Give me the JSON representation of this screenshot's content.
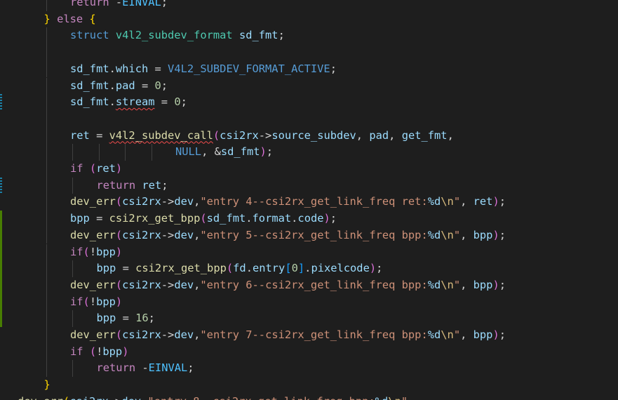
{
  "theme": {
    "background": "#1e1e1e",
    "colors": {
      "default": "#d4d4d4",
      "variable": "#9cdcfe",
      "keyword_control": "#c586c0",
      "keyword_type": "#569cd6",
      "type": "#4ec9b0",
      "function": "#dcdcaa",
      "string": "#ce9178",
      "number": "#b5cea8",
      "constant": "#4fc1ff",
      "escape": "#d7ba7d",
      "macro": "#569cd6",
      "bracket_yellow": "#ffd700",
      "bracket_purple": "#da70d6",
      "bracket_blue": "#179fff",
      "error_squiggle": "#f14c4c"
    },
    "gutter_marks": [
      {
        "line": 6,
        "span": 1,
        "color": "#1b81a8",
        "style": "dashed"
      },
      {
        "line": 11,
        "span": 1,
        "color": "#1b81a8",
        "style": "dashed"
      },
      {
        "line": 13,
        "span": 7,
        "color": "#487e02",
        "style": "solid"
      }
    ]
  },
  "lines": [
    {
      "indent": 2,
      "guides": [
        1
      ],
      "tokens": [
        {
          "t": "return",
          "c": "keyword_control"
        },
        {
          "t": " -"
        },
        {
          "t": "EINVAL",
          "c": "constant"
        },
        {
          "t": ";"
        }
      ]
    },
    {
      "indent": 1,
      "guides": [],
      "tokens": [
        {
          "t": "}",
          "c": "bracket_yellow"
        },
        {
          "t": " "
        },
        {
          "t": "else",
          "c": "keyword_control"
        },
        {
          "t": " "
        },
        {
          "t": "{",
          "c": "bracket_yellow"
        }
      ]
    },
    {
      "indent": 2,
      "guides": [
        1
      ],
      "tokens": [
        {
          "t": "struct",
          "c": "keyword_type"
        },
        {
          "t": " "
        },
        {
          "t": "v4l2_subdev_format",
          "c": "type"
        },
        {
          "t": " "
        },
        {
          "t": "sd_fmt",
          "c": "variable"
        },
        {
          "t": ";"
        }
      ]
    },
    {
      "indent": 0,
      "guides": [
        1
      ],
      "tokens": []
    },
    {
      "indent": 2,
      "guides": [
        1
      ],
      "tokens": [
        {
          "t": "sd_fmt",
          "c": "variable"
        },
        {
          "t": "."
        },
        {
          "t": "which",
          "c": "variable"
        },
        {
          "t": " = "
        },
        {
          "t": "V4L2_SUBDEV_FORMAT_ACTIVE",
          "c": "macro"
        },
        {
          "t": ";"
        }
      ]
    },
    {
      "indent": 2,
      "guides": [
        1
      ],
      "tokens": [
        {
          "t": "sd_fmt",
          "c": "variable"
        },
        {
          "t": "."
        },
        {
          "t": "pad",
          "c": "variable"
        },
        {
          "t": " = "
        },
        {
          "t": "0",
          "c": "number"
        },
        {
          "t": ";"
        }
      ]
    },
    {
      "indent": 2,
      "guides": [
        1
      ],
      "tokens": [
        {
          "t": "sd_fmt",
          "c": "variable"
        },
        {
          "t": "."
        },
        {
          "t": "stream",
          "c": "variable",
          "squiggle": true
        },
        {
          "t": " = "
        },
        {
          "t": "0",
          "c": "number"
        },
        {
          "t": ";"
        }
      ]
    },
    {
      "indent": 0,
      "guides": [
        1
      ],
      "tokens": []
    },
    {
      "indent": 2,
      "guides": [
        1
      ],
      "tokens": [
        {
          "t": "ret",
          "c": "variable"
        },
        {
          "t": " = "
        },
        {
          "t": "v4l2_subdev_call",
          "c": "function",
          "squiggle": true
        },
        {
          "t": "(",
          "c": "bracket_purple"
        },
        {
          "t": "csi2rx",
          "c": "variable"
        },
        {
          "t": "->"
        },
        {
          "t": "source_subdev",
          "c": "variable"
        },
        {
          "t": ", "
        },
        {
          "t": "pad",
          "c": "variable"
        },
        {
          "t": ", "
        },
        {
          "t": "get_fmt",
          "c": "variable"
        },
        {
          "t": ","
        }
      ]
    },
    {
      "indent": 6,
      "guides": [
        1,
        2,
        3,
        4,
        5
      ],
      "tokens": [
        {
          "t": "NULL",
          "c": "macro"
        },
        {
          "t": ", &"
        },
        {
          "t": "sd_fmt",
          "c": "variable"
        },
        {
          "t": ")",
          "c": "bracket_purple"
        },
        {
          "t": ";"
        }
      ]
    },
    {
      "indent": 2,
      "guides": [
        1
      ],
      "tokens": [
        {
          "t": "if",
          "c": "keyword_control"
        },
        {
          "t": " "
        },
        {
          "t": "(",
          "c": "bracket_purple"
        },
        {
          "t": "ret",
          "c": "variable"
        },
        {
          "t": ")",
          "c": "bracket_purple"
        }
      ]
    },
    {
      "indent": 3,
      "guides": [
        1,
        2
      ],
      "tokens": [
        {
          "t": "return",
          "c": "keyword_control"
        },
        {
          "t": " "
        },
        {
          "t": "ret",
          "c": "variable"
        },
        {
          "t": ";"
        }
      ]
    },
    {
      "indent": 2,
      "guides": [
        1
      ],
      "tokens": [
        {
          "t": "dev_err",
          "c": "function"
        },
        {
          "t": "(",
          "c": "bracket_purple"
        },
        {
          "t": "csi2rx",
          "c": "variable"
        },
        {
          "t": "->"
        },
        {
          "t": "dev",
          "c": "variable"
        },
        {
          "t": ","
        },
        {
          "t": "\"entry 4--csi2rx_get_link_freq ret:",
          "c": "string"
        },
        {
          "t": "%d",
          "c": "variable"
        },
        {
          "t": "\\n",
          "c": "escape"
        },
        {
          "t": "\"",
          "c": "string"
        },
        {
          "t": ", "
        },
        {
          "t": "ret",
          "c": "variable"
        },
        {
          "t": ")",
          "c": "bracket_purple"
        },
        {
          "t": ";"
        }
      ]
    },
    {
      "indent": 2,
      "guides": [
        1
      ],
      "tokens": [
        {
          "t": "bpp",
          "c": "variable"
        },
        {
          "t": " = "
        },
        {
          "t": "csi2rx_get_bpp",
          "c": "function"
        },
        {
          "t": "(",
          "c": "bracket_purple"
        },
        {
          "t": "sd_fmt",
          "c": "variable"
        },
        {
          "t": "."
        },
        {
          "t": "format",
          "c": "variable"
        },
        {
          "t": "."
        },
        {
          "t": "code",
          "c": "variable"
        },
        {
          "t": ")",
          "c": "bracket_purple"
        },
        {
          "t": ";"
        }
      ]
    },
    {
      "indent": 2,
      "guides": [
        1
      ],
      "tokens": [
        {
          "t": "dev_err",
          "c": "function"
        },
        {
          "t": "(",
          "c": "bracket_purple"
        },
        {
          "t": "csi2rx",
          "c": "variable"
        },
        {
          "t": "->"
        },
        {
          "t": "dev",
          "c": "variable"
        },
        {
          "t": ","
        },
        {
          "t": "\"entry 5--csi2rx_get_link_freq bpp:",
          "c": "string"
        },
        {
          "t": "%d",
          "c": "variable"
        },
        {
          "t": "\\n",
          "c": "escape"
        },
        {
          "t": "\"",
          "c": "string"
        },
        {
          "t": ", "
        },
        {
          "t": "bpp",
          "c": "variable"
        },
        {
          "t": ")",
          "c": "bracket_purple"
        },
        {
          "t": ";"
        }
      ]
    },
    {
      "indent": 2,
      "guides": [
        1
      ],
      "tokens": [
        {
          "t": "if",
          "c": "keyword_control"
        },
        {
          "t": "(",
          "c": "bracket_purple"
        },
        {
          "t": "!"
        },
        {
          "t": "bpp",
          "c": "variable"
        },
        {
          "t": ")",
          "c": "bracket_purple"
        }
      ]
    },
    {
      "indent": 3,
      "guides": [
        1,
        2
      ],
      "tokens": [
        {
          "t": "bpp",
          "c": "variable"
        },
        {
          "t": " = "
        },
        {
          "t": "csi2rx_get_bpp",
          "c": "function"
        },
        {
          "t": "(",
          "c": "bracket_purple"
        },
        {
          "t": "fd",
          "c": "variable"
        },
        {
          "t": "."
        },
        {
          "t": "entry",
          "c": "variable"
        },
        {
          "t": "[",
          "c": "bracket_blue"
        },
        {
          "t": "0",
          "c": "number"
        },
        {
          "t": "]",
          "c": "bracket_blue"
        },
        {
          "t": "."
        },
        {
          "t": "pixelcode",
          "c": "variable"
        },
        {
          "t": ")",
          "c": "bracket_purple"
        },
        {
          "t": ";"
        }
      ]
    },
    {
      "indent": 2,
      "guides": [
        1
      ],
      "tokens": [
        {
          "t": "dev_err",
          "c": "function"
        },
        {
          "t": "(",
          "c": "bracket_purple"
        },
        {
          "t": "csi2rx",
          "c": "variable"
        },
        {
          "t": "->"
        },
        {
          "t": "dev",
          "c": "variable"
        },
        {
          "t": ","
        },
        {
          "t": "\"entry 6--csi2rx_get_link_freq bpp:",
          "c": "string"
        },
        {
          "t": "%d",
          "c": "variable"
        },
        {
          "t": "\\n",
          "c": "escape"
        },
        {
          "t": "\"",
          "c": "string"
        },
        {
          "t": ", "
        },
        {
          "t": "bpp",
          "c": "variable"
        },
        {
          "t": ")",
          "c": "bracket_purple"
        },
        {
          "t": ";"
        }
      ]
    },
    {
      "indent": 2,
      "guides": [
        1
      ],
      "tokens": [
        {
          "t": "if",
          "c": "keyword_control"
        },
        {
          "t": "(",
          "c": "bracket_purple"
        },
        {
          "t": "!"
        },
        {
          "t": "bpp",
          "c": "variable"
        },
        {
          "t": ")",
          "c": "bracket_purple"
        }
      ]
    },
    {
      "indent": 3,
      "guides": [
        1,
        2
      ],
      "tokens": [
        {
          "t": "bpp",
          "c": "variable"
        },
        {
          "t": " = "
        },
        {
          "t": "16",
          "c": "number"
        },
        {
          "t": ";"
        }
      ]
    },
    {
      "indent": 2,
      "guides": [
        1
      ],
      "tokens": [
        {
          "t": "dev_err",
          "c": "function"
        },
        {
          "t": "(",
          "c": "bracket_purple"
        },
        {
          "t": "csi2rx",
          "c": "variable"
        },
        {
          "t": "->"
        },
        {
          "t": "dev",
          "c": "variable"
        },
        {
          "t": ","
        },
        {
          "t": "\"entry 7--csi2rx_get_link_freq bpp:",
          "c": "string"
        },
        {
          "t": "%d",
          "c": "variable"
        },
        {
          "t": "\\n",
          "c": "escape"
        },
        {
          "t": "\"",
          "c": "string"
        },
        {
          "t": ", "
        },
        {
          "t": "bpp",
          "c": "variable"
        },
        {
          "t": ")",
          "c": "bracket_purple"
        },
        {
          "t": ";"
        }
      ]
    },
    {
      "indent": 2,
      "guides": [
        1
      ],
      "tokens": [
        {
          "t": "if",
          "c": "keyword_control"
        },
        {
          "t": " "
        },
        {
          "t": "(",
          "c": "bracket_purple"
        },
        {
          "t": "!"
        },
        {
          "t": "bpp",
          "c": "variable"
        },
        {
          "t": ")",
          "c": "bracket_purple"
        }
      ]
    },
    {
      "indent": 3,
      "guides": [
        1,
        2
      ],
      "tokens": [
        {
          "t": "return",
          "c": "keyword_control"
        },
        {
          "t": " -"
        },
        {
          "t": "EINVAL",
          "c": "constant"
        },
        {
          "t": ";"
        }
      ]
    },
    {
      "indent": 1,
      "guides": [],
      "tokens": [
        {
          "t": "}",
          "c": "bracket_yellow"
        }
      ]
    },
    {
      "indent": 0,
      "guides": [],
      "partial": true,
      "tokens": [
        {
          "t": "dev_err",
          "c": "function"
        },
        {
          "t": "(",
          "c": "bracket_yellow"
        },
        {
          "t": "csi2rx",
          "c": "variable"
        },
        {
          "t": "->"
        },
        {
          "t": "dev",
          "c": "variable"
        },
        {
          "t": ","
        },
        {
          "t": "\"entry 8--csi2rx_get_link_freq bpp:",
          "c": "string"
        },
        {
          "t": "%d",
          "c": "variable"
        },
        {
          "t": "\\n",
          "c": "escape"
        },
        {
          "t": "\"",
          "c": "string"
        },
        {
          "t": ", "
        }
      ]
    }
  ]
}
